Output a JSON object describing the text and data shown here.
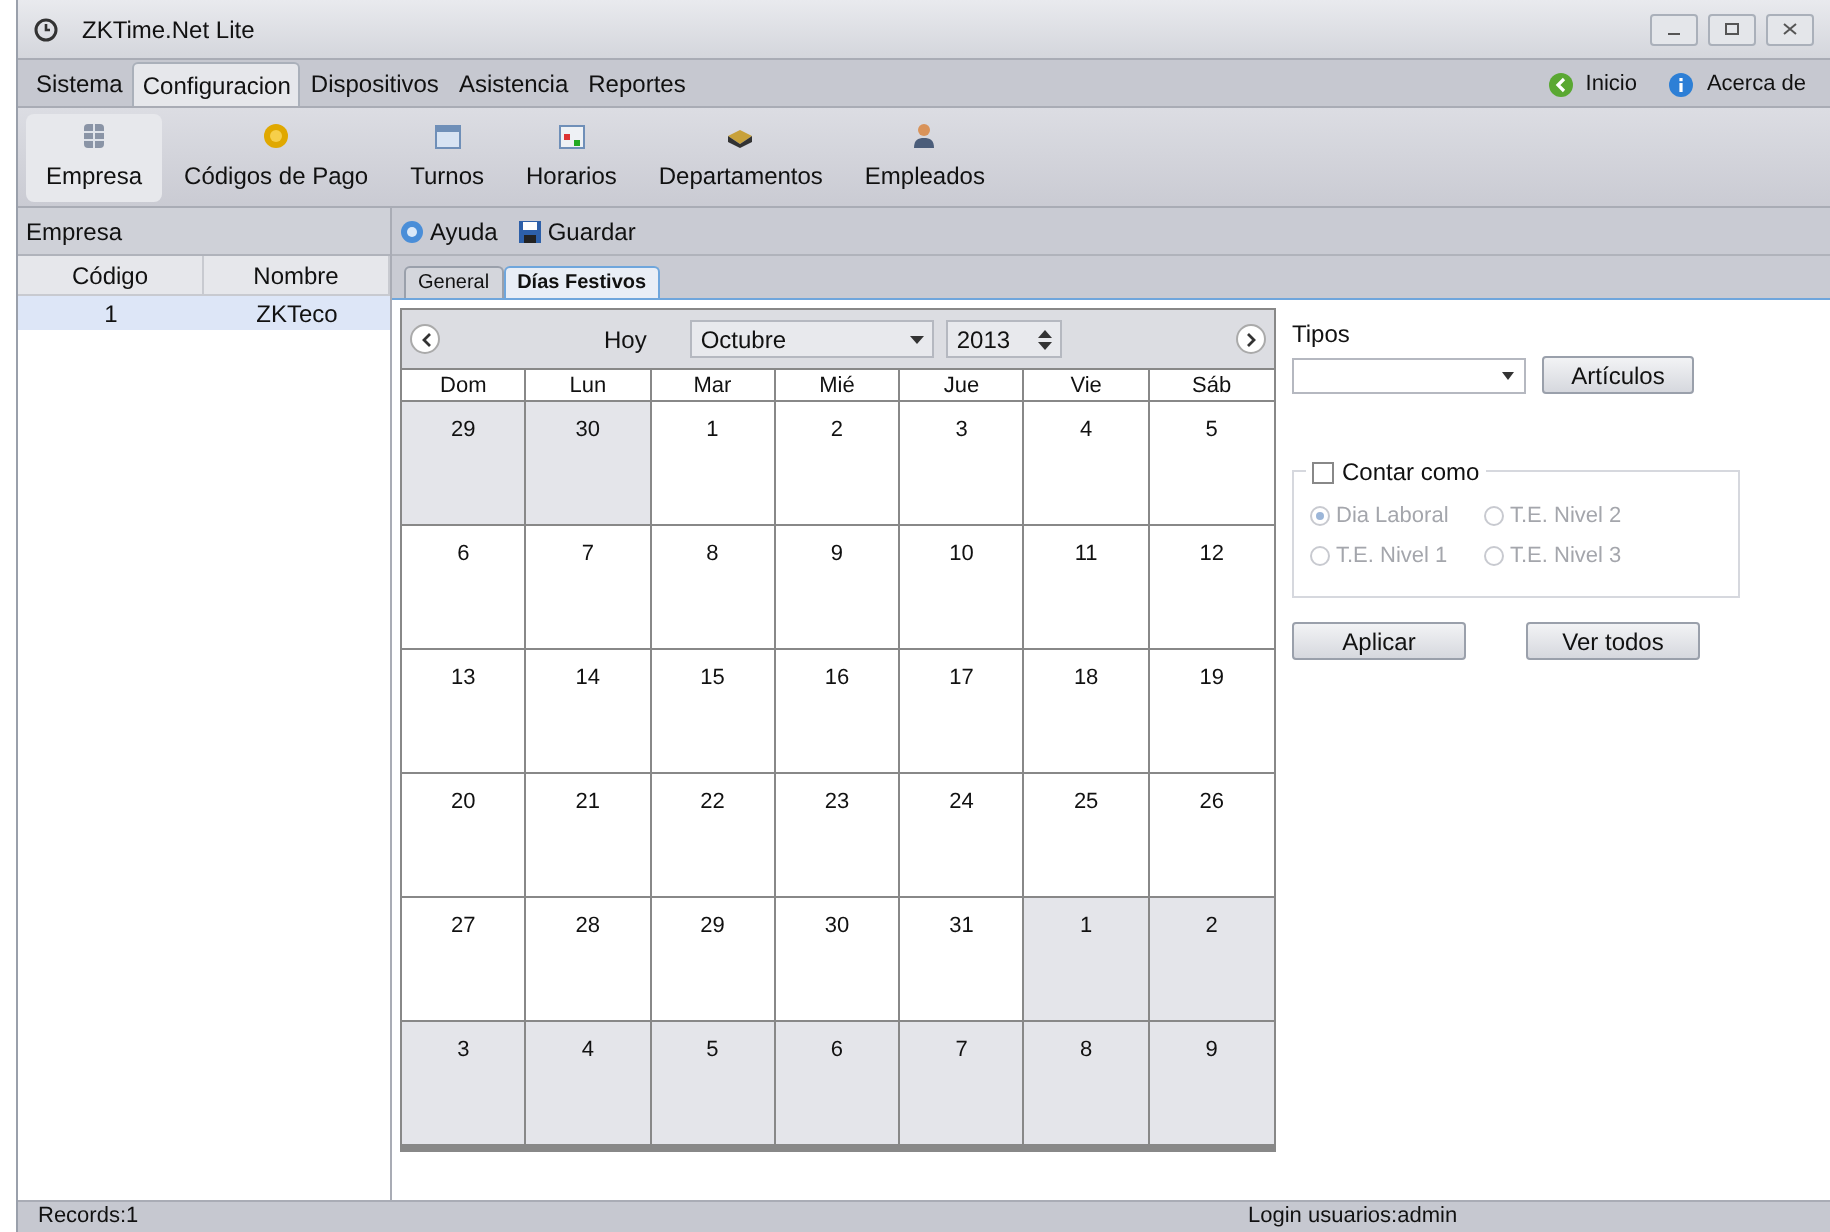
{
  "window": {
    "title": "ZKTime.Net Lite"
  },
  "menu": [
    {
      "label": "Sistema",
      "selected": false
    },
    {
      "label": "Configuracion",
      "selected": true
    },
    {
      "label": "Dispositivos",
      "selected": false
    },
    {
      "label": "Asistencia",
      "selected": false
    },
    {
      "label": "Reportes",
      "selected": false
    }
  ],
  "menu_right": [
    {
      "label": "Inicio",
      "kind": "home"
    },
    {
      "label": "Acerca de",
      "kind": "info"
    }
  ],
  "toolbar": [
    {
      "label": "Empresa",
      "kind": "database",
      "selected": true
    },
    {
      "label": "Códigos de Pago",
      "kind": "coin",
      "selected": false
    },
    {
      "label": "Turnos",
      "kind": "calendar",
      "selected": false
    },
    {
      "label": "Horarios",
      "kind": "grid",
      "selected": false
    },
    {
      "label": "Departamentos",
      "kind": "folder",
      "selected": false
    },
    {
      "label": "Empleados",
      "kind": "person",
      "selected": false
    }
  ],
  "left_panel": {
    "title": "Empresa",
    "columns": [
      "Código",
      "Nombre"
    ],
    "rows": [
      {
        "cells": [
          "1",
          "ZKTeco"
        ],
        "selected": true
      }
    ]
  },
  "actions": [
    {
      "label": "Ayuda",
      "kind": "help"
    },
    {
      "label": "Guardar",
      "kind": "save"
    }
  ],
  "tabs": [
    {
      "label": "General",
      "selected": false
    },
    {
      "label": "Días Festivos",
      "selected": true
    }
  ],
  "calendar": {
    "today": "Hoy",
    "month": "Octubre",
    "year": "2013",
    "weekdays": [
      "Dom",
      "Lun",
      "Mar",
      "Mié",
      "Jue",
      "Vie",
      "Sáb"
    ],
    "weeks": [
      [
        {
          "day": "29",
          "other_month": true
        },
        {
          "day": "30",
          "other_month": true
        },
        {
          "day": "1",
          "other_month": false
        },
        {
          "day": "2",
          "other_month": false
        },
        {
          "day": "3",
          "other_month": false
        },
        {
          "day": "4",
          "other_month": false
        },
        {
          "day": "5",
          "other_month": false
        }
      ],
      [
        {
          "day": "6",
          "other_month": false
        },
        {
          "day": "7",
          "other_month": false
        },
        {
          "day": "8",
          "other_month": false
        },
        {
          "day": "9",
          "other_month": false
        },
        {
          "day": "10",
          "other_month": false
        },
        {
          "day": "11",
          "other_month": false
        },
        {
          "day": "12",
          "other_month": false
        }
      ],
      [
        {
          "day": "13",
          "other_month": false
        },
        {
          "day": "14",
          "other_month": false
        },
        {
          "day": "15",
          "other_month": false
        },
        {
          "day": "16",
          "other_month": false
        },
        {
          "day": "17",
          "other_month": false
        },
        {
          "day": "18",
          "other_month": false
        },
        {
          "day": "19",
          "other_month": false
        }
      ],
      [
        {
          "day": "20",
          "other_month": false
        },
        {
          "day": "21",
          "other_month": false
        },
        {
          "day": "22",
          "other_month": false
        },
        {
          "day": "23",
          "other_month": false
        },
        {
          "day": "24",
          "other_month": false
        },
        {
          "day": "25",
          "other_month": false
        },
        {
          "day": "26",
          "other_month": false
        }
      ],
      [
        {
          "day": "27",
          "other_month": false
        },
        {
          "day": "28",
          "other_month": false
        },
        {
          "day": "29",
          "other_month": false
        },
        {
          "day": "30",
          "other_month": false
        },
        {
          "day": "31",
          "other_month": false
        },
        {
          "day": "1",
          "other_month": true
        },
        {
          "day": "2",
          "other_month": true
        }
      ],
      [
        {
          "day": "3",
          "other_month": true
        },
        {
          "day": "4",
          "other_month": true
        },
        {
          "day": "5",
          "other_month": true
        },
        {
          "day": "6",
          "other_month": true
        },
        {
          "day": "7",
          "other_month": true
        },
        {
          "day": "8",
          "other_month": true
        },
        {
          "day": "9",
          "other_month": true
        }
      ]
    ]
  },
  "tipos": {
    "label": "Tipos",
    "button": "Artículos"
  },
  "contar_como": {
    "label": "Contar como",
    "checked": false,
    "options": [
      {
        "label": "Dia Laboral",
        "selected": true,
        "disabled": true
      },
      {
        "label": "T.E. Nivel 2",
        "selected": false,
        "disabled": true
      },
      {
        "label": "T.E. Nivel 1",
        "selected": false,
        "disabled": true
      },
      {
        "label": "T.E. Nivel 3",
        "selected": false,
        "disabled": true
      }
    ]
  },
  "buttons": [
    "Aplicar",
    "Ver todos"
  ],
  "status_bar": {
    "left": "Records:1",
    "right": "Login usuarios:admin"
  }
}
